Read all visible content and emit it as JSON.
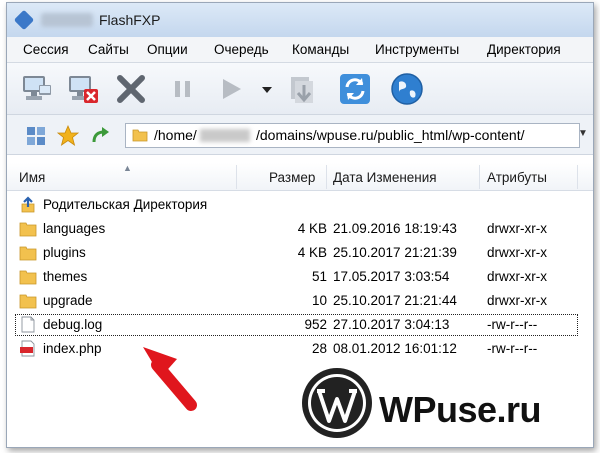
{
  "window": {
    "title": "FlashFXP"
  },
  "menu": [
    "Сессия",
    "Сайты",
    "Опции",
    "Очередь",
    "Команды",
    "Инструменты",
    "Директория"
  ],
  "path": {
    "prefix": "/home/",
    "suffix": "/domains/wpuse.ru/public_html/wp-content/"
  },
  "columns": {
    "name": "Имя",
    "size": "Размер",
    "date": "Дата Изменения",
    "attrs": "Атрибуты"
  },
  "parent_dir": "Родительская Директория",
  "files": [
    {
      "name": "languages",
      "size": "4 KB",
      "date": "21.09.2016 18:19:43",
      "attrs": "drwxr-xr-x",
      "type": "folder"
    },
    {
      "name": "plugins",
      "size": "4 KB",
      "date": "25.10.2017 21:21:39",
      "attrs": "drwxr-xr-x",
      "type": "folder"
    },
    {
      "name": "themes",
      "size": "51",
      "date": "17.05.2017 3:03:54",
      "attrs": "drwxr-xr-x",
      "type": "folder"
    },
    {
      "name": "upgrade",
      "size": "10",
      "date": "25.10.2017 21:21:44",
      "attrs": "drwxr-xr-x",
      "type": "folder"
    },
    {
      "name": "debug.log",
      "size": "952",
      "date": "27.10.2017 3:04:13",
      "attrs": "-rw-r--r--",
      "type": "file"
    },
    {
      "name": "index.php",
      "size": "28",
      "date": "08.01.2012 16:01:12",
      "attrs": "-rw-r--r--",
      "type": "php"
    }
  ],
  "watermark": {
    "text": "WPuse.ru"
  },
  "colors": {
    "arrow": "#e0161d",
    "folder": "#f2c14e",
    "accent": "#3b78c8"
  }
}
